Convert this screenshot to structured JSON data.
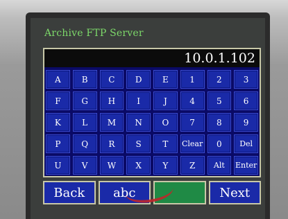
{
  "title": "Archive FTP Server",
  "ip_value": "10.0.1.102",
  "keys": [
    "A",
    "B",
    "C",
    "D",
    "E",
    "1",
    "2",
    "3",
    "F",
    "G",
    "H",
    "I",
    "J",
    "4",
    "5",
    "6",
    "K",
    "L",
    "M",
    "N",
    "O",
    "7",
    "8",
    "9",
    "P",
    "Q",
    "R",
    "S",
    "T",
    "Clear",
    "0",
    "Del",
    "U",
    "V",
    "W",
    "X",
    "Y",
    "Z",
    "Alt",
    "Enter"
  ],
  "buttons": {
    "back": "Back",
    "abc": "abc",
    "blank": "",
    "next": "Next"
  },
  "colors": {
    "title_green": "#7dd96a",
    "key_blue": "#1a2aa8",
    "field_black": "#0b0b0b",
    "confirm_green": "#1f8a45"
  }
}
